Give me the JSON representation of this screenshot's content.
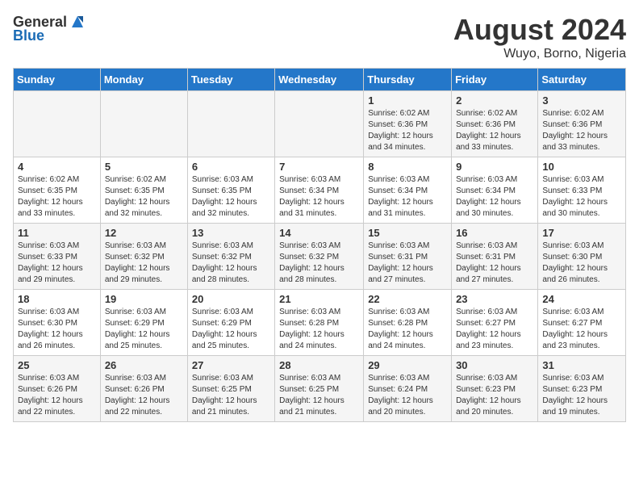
{
  "header": {
    "logo_general": "General",
    "logo_blue": "Blue",
    "month_year": "August 2024",
    "location": "Wuyo, Borno, Nigeria"
  },
  "days_of_week": [
    "Sunday",
    "Monday",
    "Tuesday",
    "Wednesday",
    "Thursday",
    "Friday",
    "Saturday"
  ],
  "weeks": [
    [
      {
        "day": "",
        "info": ""
      },
      {
        "day": "",
        "info": ""
      },
      {
        "day": "",
        "info": ""
      },
      {
        "day": "",
        "info": ""
      },
      {
        "day": "1",
        "info": "Sunrise: 6:02 AM\nSunset: 6:36 PM\nDaylight: 12 hours\nand 34 minutes."
      },
      {
        "day": "2",
        "info": "Sunrise: 6:02 AM\nSunset: 6:36 PM\nDaylight: 12 hours\nand 33 minutes."
      },
      {
        "day": "3",
        "info": "Sunrise: 6:02 AM\nSunset: 6:36 PM\nDaylight: 12 hours\nand 33 minutes."
      }
    ],
    [
      {
        "day": "4",
        "info": "Sunrise: 6:02 AM\nSunset: 6:35 PM\nDaylight: 12 hours\nand 33 minutes."
      },
      {
        "day": "5",
        "info": "Sunrise: 6:02 AM\nSunset: 6:35 PM\nDaylight: 12 hours\nand 32 minutes."
      },
      {
        "day": "6",
        "info": "Sunrise: 6:03 AM\nSunset: 6:35 PM\nDaylight: 12 hours\nand 32 minutes."
      },
      {
        "day": "7",
        "info": "Sunrise: 6:03 AM\nSunset: 6:34 PM\nDaylight: 12 hours\nand 31 minutes."
      },
      {
        "day": "8",
        "info": "Sunrise: 6:03 AM\nSunset: 6:34 PM\nDaylight: 12 hours\nand 31 minutes."
      },
      {
        "day": "9",
        "info": "Sunrise: 6:03 AM\nSunset: 6:34 PM\nDaylight: 12 hours\nand 30 minutes."
      },
      {
        "day": "10",
        "info": "Sunrise: 6:03 AM\nSunset: 6:33 PM\nDaylight: 12 hours\nand 30 minutes."
      }
    ],
    [
      {
        "day": "11",
        "info": "Sunrise: 6:03 AM\nSunset: 6:33 PM\nDaylight: 12 hours\nand 29 minutes."
      },
      {
        "day": "12",
        "info": "Sunrise: 6:03 AM\nSunset: 6:32 PM\nDaylight: 12 hours\nand 29 minutes."
      },
      {
        "day": "13",
        "info": "Sunrise: 6:03 AM\nSunset: 6:32 PM\nDaylight: 12 hours\nand 28 minutes."
      },
      {
        "day": "14",
        "info": "Sunrise: 6:03 AM\nSunset: 6:32 PM\nDaylight: 12 hours\nand 28 minutes."
      },
      {
        "day": "15",
        "info": "Sunrise: 6:03 AM\nSunset: 6:31 PM\nDaylight: 12 hours\nand 27 minutes."
      },
      {
        "day": "16",
        "info": "Sunrise: 6:03 AM\nSunset: 6:31 PM\nDaylight: 12 hours\nand 27 minutes."
      },
      {
        "day": "17",
        "info": "Sunrise: 6:03 AM\nSunset: 6:30 PM\nDaylight: 12 hours\nand 26 minutes."
      }
    ],
    [
      {
        "day": "18",
        "info": "Sunrise: 6:03 AM\nSunset: 6:30 PM\nDaylight: 12 hours\nand 26 minutes."
      },
      {
        "day": "19",
        "info": "Sunrise: 6:03 AM\nSunset: 6:29 PM\nDaylight: 12 hours\nand 25 minutes."
      },
      {
        "day": "20",
        "info": "Sunrise: 6:03 AM\nSunset: 6:29 PM\nDaylight: 12 hours\nand 25 minutes."
      },
      {
        "day": "21",
        "info": "Sunrise: 6:03 AM\nSunset: 6:28 PM\nDaylight: 12 hours\nand 24 minutes."
      },
      {
        "day": "22",
        "info": "Sunrise: 6:03 AM\nSunset: 6:28 PM\nDaylight: 12 hours\nand 24 minutes."
      },
      {
        "day": "23",
        "info": "Sunrise: 6:03 AM\nSunset: 6:27 PM\nDaylight: 12 hours\nand 23 minutes."
      },
      {
        "day": "24",
        "info": "Sunrise: 6:03 AM\nSunset: 6:27 PM\nDaylight: 12 hours\nand 23 minutes."
      }
    ],
    [
      {
        "day": "25",
        "info": "Sunrise: 6:03 AM\nSunset: 6:26 PM\nDaylight: 12 hours\nand 22 minutes."
      },
      {
        "day": "26",
        "info": "Sunrise: 6:03 AM\nSunset: 6:26 PM\nDaylight: 12 hours\nand 22 minutes."
      },
      {
        "day": "27",
        "info": "Sunrise: 6:03 AM\nSunset: 6:25 PM\nDaylight: 12 hours\nand 21 minutes."
      },
      {
        "day": "28",
        "info": "Sunrise: 6:03 AM\nSunset: 6:25 PM\nDaylight: 12 hours\nand 21 minutes."
      },
      {
        "day": "29",
        "info": "Sunrise: 6:03 AM\nSunset: 6:24 PM\nDaylight: 12 hours\nand 20 minutes."
      },
      {
        "day": "30",
        "info": "Sunrise: 6:03 AM\nSunset: 6:23 PM\nDaylight: 12 hours\nand 20 minutes."
      },
      {
        "day": "31",
        "info": "Sunrise: 6:03 AM\nSunset: 6:23 PM\nDaylight: 12 hours\nand 19 minutes."
      }
    ]
  ]
}
